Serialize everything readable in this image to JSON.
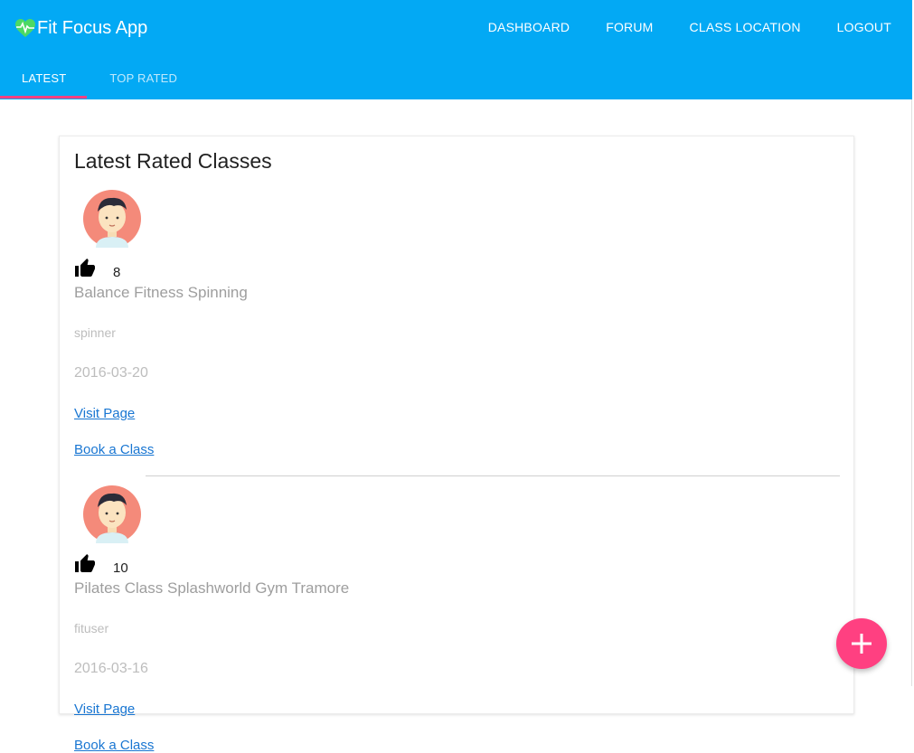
{
  "app": {
    "title": "Fit Focus App",
    "brand_color": "#03a9f4",
    "accent_color": "#ff4081",
    "logo_icon": "heart-pulse-icon"
  },
  "nav": {
    "items": [
      {
        "label": "DASHBOARD"
      },
      {
        "label": "FORUM"
      },
      {
        "label": "CLASS LOCATION"
      },
      {
        "label": "LOGOUT"
      }
    ]
  },
  "tabs": [
    {
      "label": "LATEST",
      "active": true
    },
    {
      "label": "TOP RATED",
      "active": false
    }
  ],
  "main": {
    "title": "Latest Rated Classes",
    "classes": [
      {
        "avatar_icon": "user-avatar-icon",
        "like_icon": "thumbs-up-icon",
        "likes": "8",
        "name": "Balance Fitness Spinning",
        "user": "spinner",
        "date": "2016-03-20",
        "visit_label": "Visit Page",
        "book_label": "Book a Class"
      },
      {
        "avatar_icon": "user-avatar-icon",
        "like_icon": "thumbs-up-icon",
        "likes": "10",
        "name": "Pilates Class Splashworld Gym Tramore",
        "user": "fituser",
        "date": "2016-03-16",
        "visit_label": "Visit Page",
        "book_label": "Book a Class"
      }
    ]
  },
  "fab": {
    "icon": "plus-icon"
  }
}
